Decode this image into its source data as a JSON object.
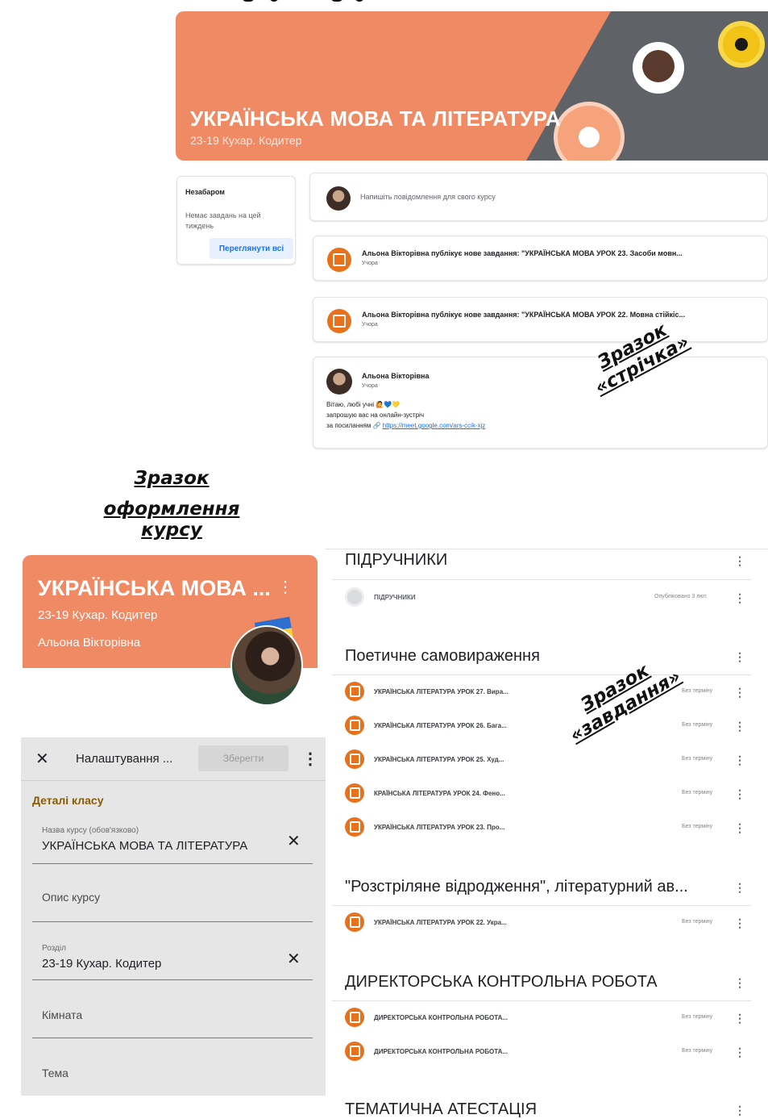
{
  "feed": {
    "course_title": "УКРАЇНСЬКА МОВА ТА ЛІТЕРАТУРА",
    "course_section": "23-19 Кухар. Кодитер",
    "upcoming": {
      "title": "Незабаром",
      "text": "Немає завдань на цей тиждень",
      "view_all": "Переглянути всі"
    },
    "compose_placeholder": "Напишіть повідомлення для свого курсу",
    "posts": [
      {
        "text": "Альона Вікторівна публікує нове завдання: \"УКРАЇНСЬКА МОВА УРОК 23. Засоби мовн...",
        "time": "Учора"
      },
      {
        "text": "Альона Вікторівна публікує нове завдання: \"УКРАЇНСЬКА МОВА УРОК 22. Мовна стійкіс...",
        "time": "Учора"
      }
    ],
    "announcement": {
      "author": "Альона Вікторівна",
      "time": "Учора",
      "line1": "Вітаю, любі учні 🙋💙💛",
      "line2": "запрошую вас на онлайн-зустріч",
      "line3": "за посиланням 🔗",
      "link": "https://meet.google.com/ars-ccik-xjz"
    },
    "sample_label": [
      "Зразок",
      "«стрічка»"
    ]
  },
  "course_sample": {
    "label": [
      "Зразок",
      "оформлення курсу"
    ],
    "title": "УКРАЇНСЬКА МОВА ...",
    "section": "23-19 Кухар. Кодитер",
    "teacher": "Альона Вікторівна"
  },
  "settings": {
    "title": "Налаштування ...",
    "save": "Зберегти",
    "section_header": "Деталі класу",
    "fields": {
      "name_label": "Назва курсу (обов'язково)",
      "name_value": "УКРАЇНСЬКА МОВА ТА ЛІТЕРАТУРА",
      "description": "Опис курсу",
      "section_label": "Розділ",
      "section_value": "23-19 Кухар. Кодитер",
      "room": "Кімната",
      "subject": "Тема"
    }
  },
  "classwork": {
    "sample_label": [
      "Зразок",
      "«завдання»"
    ],
    "topics": [
      {
        "title": "ПІДРУЧНИКИ",
        "items": [
          {
            "text": "ПІДРУЧНИКИ",
            "status": "Опубліковано 3 лют."
          }
        ]
      },
      {
        "title": "Поетичне самовираження",
        "items": [
          {
            "text": "УКРАЇНСЬКА ЛІТЕРАТУРА УРОК 27. Вира...",
            "status": "Без терміну"
          },
          {
            "text": "УКРАЇНСЬКА ЛІТЕРАТУРА УРОК 26. Бага...",
            "status": "Без терміну"
          },
          {
            "text": "УКРАЇНСЬКА ЛІТЕРАТУРА УРОК 25. Худ...",
            "status": "Без терміну"
          },
          {
            "text": "КРАЇНСЬКА ЛІТЕРАТУРА УРОК 24. Фено...",
            "status": "Без терміну"
          },
          {
            "text": "УКРАЇНСЬКА ЛІТЕРАТУРА УРОК 23. Про...",
            "status": "Без терміну"
          }
        ]
      },
      {
        "title": "\"Розстріляне відродження\", літературний ав...",
        "items": [
          {
            "text": "УКРАЇНСЬКА ЛІТЕРАТУРА УРОК 22. Укра...",
            "status": "Без терміну"
          }
        ]
      },
      {
        "title": "ДИРЕКТОРСЬКА КОНТРОЛЬНА РОБОТА",
        "items": [
          {
            "text": "ДИРЕКТОРСЬКА КОНТРОЛЬНА РОБОТА...",
            "status": "Без терміну"
          },
          {
            "text": "ДИРЕКТОРСЬКА КОНТРОЛЬНА РОБОТА...",
            "status": "Без терміну"
          }
        ]
      },
      {
        "title": "ТЕМАТИЧНА АТЕСТАЦІЯ",
        "items": []
      }
    ]
  },
  "colors": {
    "accent": "#f08a64",
    "assignment_icon": "#e8711c",
    "link": "#1a73e8"
  }
}
